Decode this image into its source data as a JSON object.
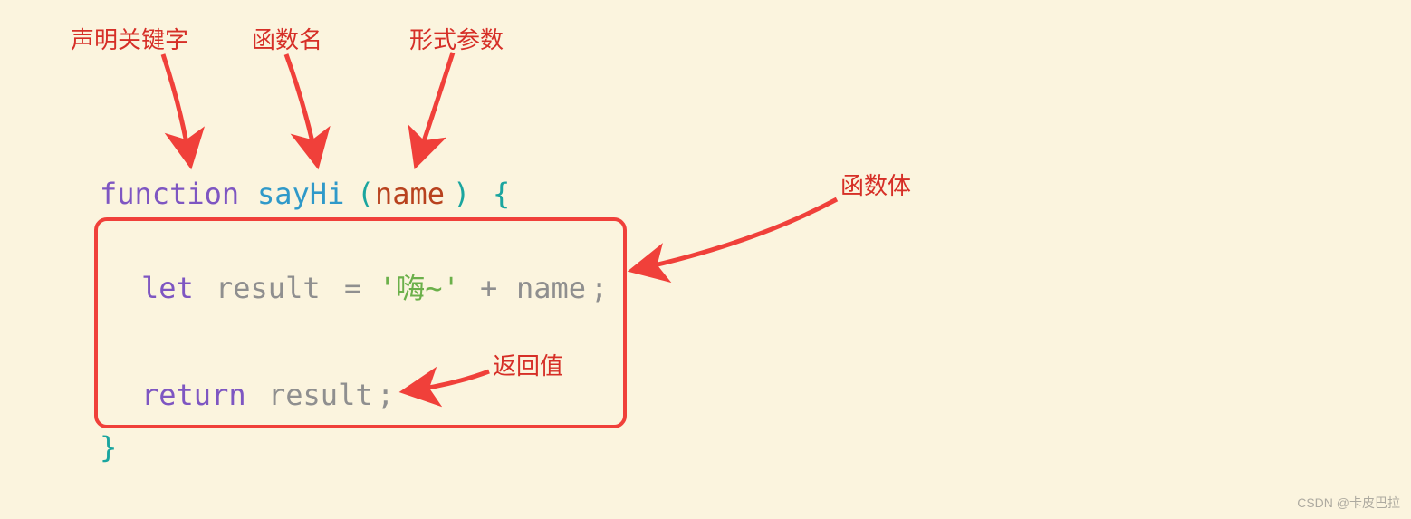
{
  "labels": {
    "keyword": "声明关键字",
    "funcname": "函数名",
    "param": "形式参数",
    "body": "函数体",
    "returnval": "返回值"
  },
  "code": {
    "kw_function": "function",
    "func_name": "sayHi",
    "paren_open": "(",
    "param_name": "name",
    "paren_close": ")",
    "brace_open": "{",
    "kw_let": "let",
    "var_result": "result",
    "eq": "=",
    "str_hi": "'嗨~'",
    "plus": "+",
    "var_name_ref": "name",
    "semi1": ";",
    "kw_return": "return",
    "ret_var": "result",
    "semi2": ";",
    "brace_close": "}"
  },
  "watermark": "CSDN @卡皮巴拉",
  "colors": {
    "bg": "#fbf4de",
    "red": "#f0403a",
    "label": "#d62f27",
    "keyword": "#7e56c2",
    "func": "#2f99c9",
    "paren": "#1aa59f",
    "param": "#b8421e",
    "plain": "#8f8f8f",
    "string": "#6bb04a"
  }
}
